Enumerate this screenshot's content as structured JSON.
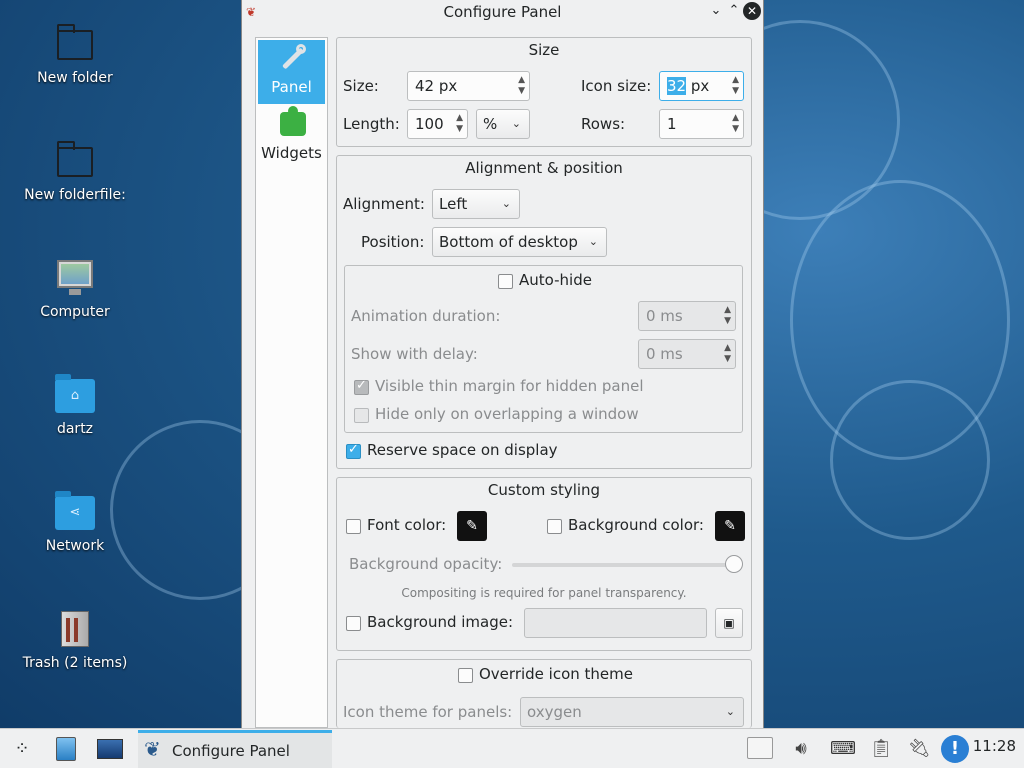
{
  "desktop": {
    "icons": [
      {
        "label": "New folder"
      },
      {
        "label": "New folderfile:"
      },
      {
        "label": "Computer"
      },
      {
        "label": "dartz"
      },
      {
        "label": "Network"
      },
      {
        "label": "Trash (2 items)"
      }
    ]
  },
  "window": {
    "title": "Configure Panel",
    "sidebar": [
      {
        "label": "Panel",
        "icon": "wrench-icon",
        "active": true
      },
      {
        "label": "Widgets",
        "icon": "puzzle-icon",
        "active": false
      }
    ],
    "size_group": {
      "title": "Size",
      "size_label": "Size:",
      "size_value": "42 px",
      "icon_size_label": "Icon size:",
      "icon_size_selected": "32",
      "icon_size_unit": " px",
      "length_label": "Length:",
      "length_value": "100",
      "length_unit": "%",
      "rows_label": "Rows:",
      "rows_value": "1"
    },
    "alignment_group": {
      "title": "Alignment & position",
      "alignment_label": "Alignment:",
      "alignment_value": "Left",
      "position_label": "Position:",
      "position_value": "Bottom of desktop",
      "autohide_label": "Auto-hide",
      "animation_label": "Animation duration:",
      "animation_value": "0 ms",
      "delay_label": "Show with delay:",
      "delay_value": "0 ms",
      "thin_margin_label": "Visible thin margin for hidden panel",
      "overlap_label": "Hide only on overlapping a window",
      "reserve_label": "Reserve space on display"
    },
    "styling_group": {
      "title": "Custom styling",
      "font_color_label": "Font color:",
      "bg_color_label": "Background color:",
      "opacity_label": "Background opacity:",
      "opacity_value": 1.0,
      "compositing_note": "Compositing is required for panel transparency.",
      "bg_image_label": "Background image:",
      "bg_image_value": ""
    },
    "icon_theme_group": {
      "override_label": "Override icon theme",
      "theme_label": "Icon theme for panels:",
      "theme_value": "oxygen"
    }
  },
  "taskbar": {
    "active_task": "Configure Panel",
    "clock": "11:28"
  },
  "colors": {
    "accent": "#3daee9",
    "window_bg": "#eff0f1",
    "desktop_bg": "#1f5a8c"
  }
}
